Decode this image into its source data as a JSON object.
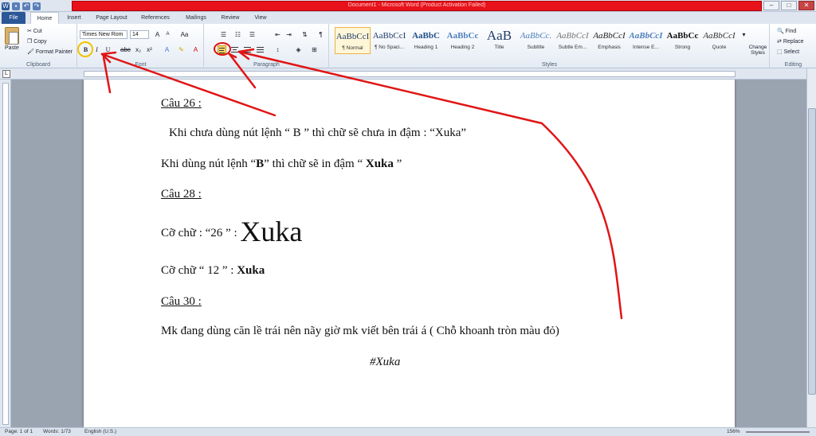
{
  "window": {
    "title": "Document1 - Microsoft Word (Product Activation Failed)"
  },
  "tabs": [
    "File",
    "Home",
    "Insert",
    "Page Layout",
    "References",
    "Mailings",
    "Review",
    "View"
  ],
  "clipboard": {
    "paste": "Paste",
    "cut": "Cut",
    "copy": "Copy",
    "format_painter": "Format Painter",
    "label": "Clipboard"
  },
  "font": {
    "name": "Times New Rom",
    "size": "14",
    "label": "Font"
  },
  "paragraph": {
    "label": "Paragraph"
  },
  "styles": {
    "label": "Styles",
    "items": [
      {
        "preview": "AaBbCcI",
        "name": "¶ Normal"
      },
      {
        "preview": "AaBbCcI",
        "name": "¶ No Spaci..."
      },
      {
        "preview": "AaBbC",
        "name": "Heading 1"
      },
      {
        "preview": "AaBbCc",
        "name": "Heading 2"
      },
      {
        "preview": "AaB",
        "name": "Title"
      },
      {
        "preview": "AaBbCc.",
        "name": "Subtitle"
      },
      {
        "preview": "AaBbCcI",
        "name": "Subtle Em..."
      },
      {
        "preview": "AaBbCcI",
        "name": "Emphasis"
      },
      {
        "preview": "AaBbCcI",
        "name": "Intense E..."
      },
      {
        "preview": "AaBbCc",
        "name": "Strong"
      },
      {
        "preview": "AaBbCcI",
        "name": "Quote"
      }
    ],
    "change": "Change Styles"
  },
  "editing": {
    "find": "Find",
    "replace": "Replace",
    "select": "Select",
    "label": "Editing"
  },
  "document": {
    "q26": "Câu 26 :",
    "l1": "Khi chưa dùng nút lệnh “ B ” thì chữ sẽ chưa in đậm : “Xuka”",
    "l2_a": "Khi dùng nút lệnh “",
    "l2_b": "B",
    "l2_c": "” thì chữ sẽ in đậm  “ ",
    "l2_d": "Xuka",
    "l2_e": " ”",
    "q28": "Câu 28 :",
    "l3_a": "Cỡ chữ : “26 ” : ",
    "l3_b": "Xuka",
    "l4_a": "Cỡ chữ “ 12 ” : ",
    "l4_b": "Xuka",
    "q30": "Câu 30 :",
    "l5": "Mk đang dùng căn lề trái nên nãy giờ mk viết bên trái á ( Chỗ khoanh tròn màu đỏ)",
    "sig": "#Xuka"
  },
  "status": {
    "page": "Page: 1 of 1",
    "words": "Words: 1/73",
    "lang": "English (U.S.)",
    "zoom": "156%"
  }
}
